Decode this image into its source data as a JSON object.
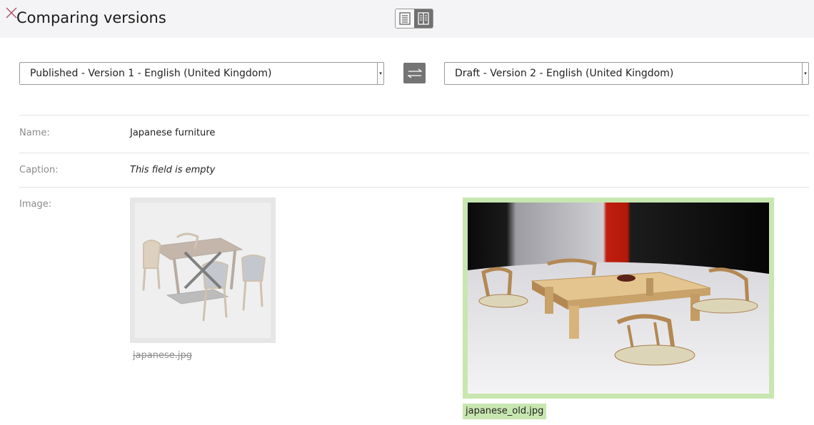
{
  "header": {
    "title": "Comparing versions",
    "close_icon": "close-icon",
    "view_toggle": {
      "single_icon": "single-column-view-icon",
      "split_icon": "side-by-side-view-icon",
      "active": "split"
    }
  },
  "compare": {
    "left_version": "Published - Version 1 - English (United Kingdom)",
    "right_version": "Draft - Version 2 - English (United Kingdom)",
    "swap_icon": "swap-arrows-icon"
  },
  "fields": {
    "name": {
      "label": "Name:",
      "value": "Japanese furniture"
    },
    "caption": {
      "label": "Caption:",
      "value": "This field is empty"
    },
    "image": {
      "label": "Image:",
      "old_filename": "japanese.jpg",
      "new_filename": "japanese_old.jpg",
      "removed_icon": "removed-x-icon"
    }
  },
  "colors": {
    "added": "#c8e6b0",
    "removed": "#e6e6e6",
    "close": "#b0506a"
  }
}
